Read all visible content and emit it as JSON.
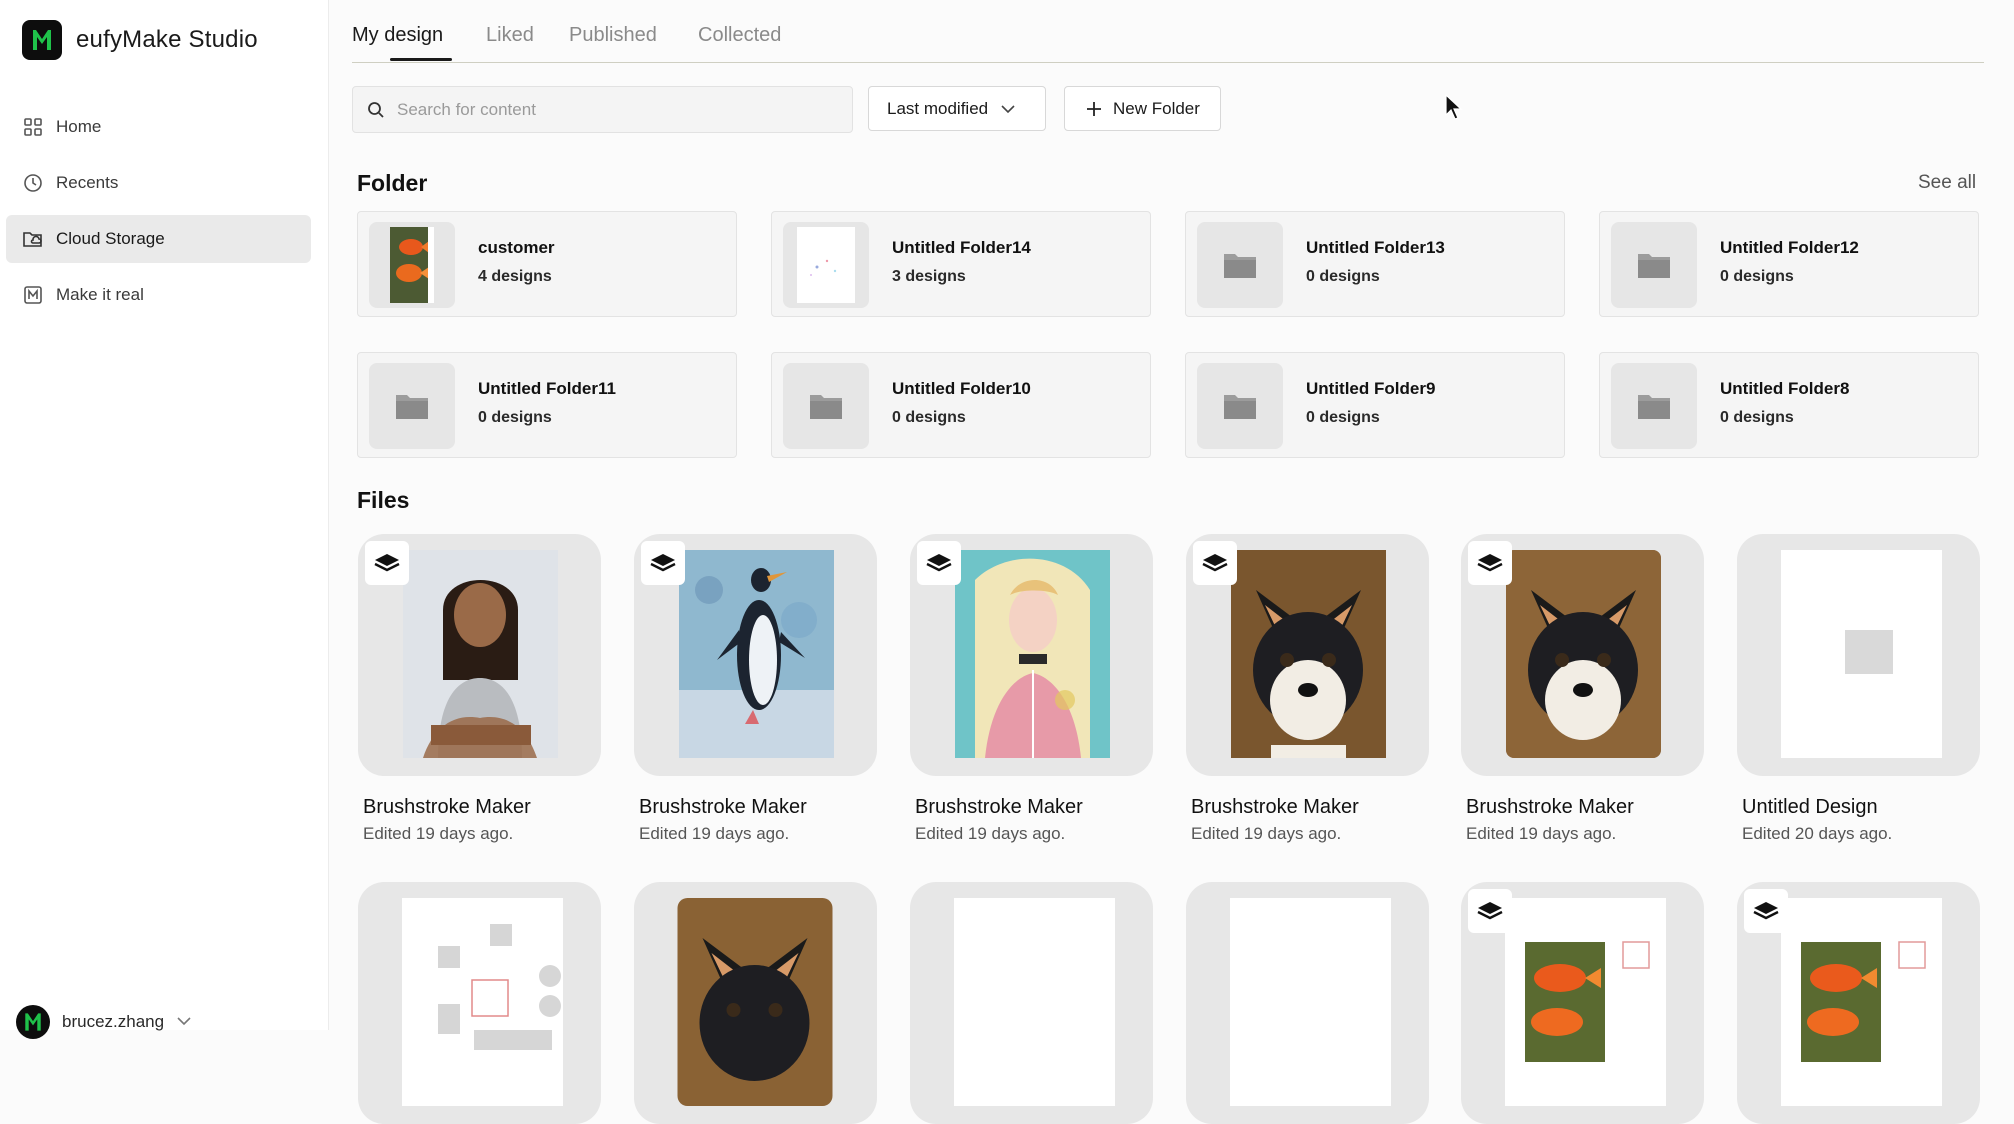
{
  "app": {
    "name": "eufyMake Studio",
    "colors": {
      "accent": "#1fc24a",
      "dark": "#0d0d0d",
      "active_nav": "#eaeaea"
    }
  },
  "sidebar": {
    "items": [
      {
        "label": "Home",
        "icon": "grid-icon"
      },
      {
        "label": "Recents",
        "icon": "clock-icon"
      },
      {
        "label": "Cloud Storage",
        "icon": "cloud-folder-icon",
        "active": true
      },
      {
        "label": "Make it real",
        "icon": "m-square-icon"
      }
    ],
    "user": {
      "name": "brucez.zhang"
    }
  },
  "tabs": [
    {
      "label": "My design",
      "active": true
    },
    {
      "label": "Liked"
    },
    {
      "label": "Published"
    },
    {
      "label": "Collected"
    }
  ],
  "toolbar": {
    "search_placeholder": "Search for content",
    "sort_label": "Last modified",
    "new_folder_label": "New Folder"
  },
  "folders": {
    "title": "Folder",
    "see_all": "See all",
    "items": [
      {
        "name": "customer",
        "count": "4 designs"
      },
      {
        "name": "Untitled Folder14",
        "count": "3 designs"
      },
      {
        "name": "Untitled Folder13",
        "count": "0 designs"
      },
      {
        "name": "Untitled Folder12",
        "count": "0 designs"
      },
      {
        "name": "Untitled Folder11",
        "count": "0 designs"
      },
      {
        "name": "Untitled Folder10",
        "count": "0 designs"
      },
      {
        "name": "Untitled Folder9",
        "count": "0 designs"
      },
      {
        "name": "Untitled Folder8",
        "count": "0 designs"
      }
    ]
  },
  "files": {
    "title": "Files",
    "items": [
      {
        "name": "Brushstroke Maker",
        "edited": "Edited 19 days ago."
      },
      {
        "name": "Brushstroke Maker",
        "edited": "Edited 19 days ago."
      },
      {
        "name": "Brushstroke Maker",
        "edited": "Edited 19 days ago."
      },
      {
        "name": "Brushstroke Maker",
        "edited": "Edited 19 days ago."
      },
      {
        "name": "Brushstroke Maker",
        "edited": "Edited 19 days ago."
      },
      {
        "name": "Untitled Design",
        "edited": "Edited 20 days ago."
      }
    ]
  }
}
